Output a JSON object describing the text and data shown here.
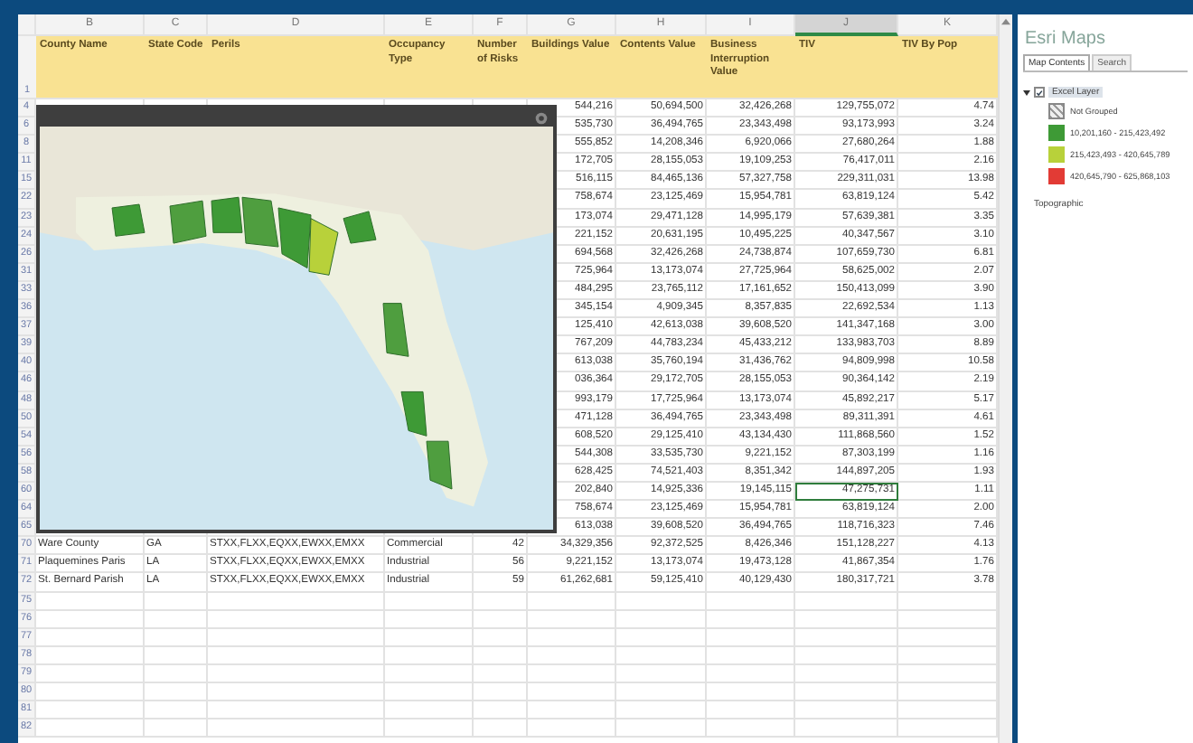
{
  "sheet": {
    "column_letters": [
      {
        "label": "B",
        "selected": false
      },
      {
        "label": "C",
        "selected": false
      },
      {
        "label": "D",
        "selected": false
      },
      {
        "label": "E",
        "selected": false
      },
      {
        "label": "F",
        "selected": false
      },
      {
        "label": "G",
        "selected": false
      },
      {
        "label": "H",
        "selected": false
      },
      {
        "label": "I",
        "selected": false
      },
      {
        "label": "J",
        "selected": true
      },
      {
        "label": "K",
        "selected": false
      }
    ],
    "header_row": {
      "row_number": "1",
      "cells": [
        "County Name",
        "State Code",
        "Perils",
        "Occupancy Type",
        "Number of Risks",
        "Buildings Value",
        "Contents Value",
        "Business Interruption Value",
        "TIV",
        "TIV By Pop"
      ]
    },
    "rows": [
      {
        "row_number": "4",
        "kind": "covered",
        "selected": false,
        "cells": [
          "544,216",
          "50,694,500",
          "32,426,268",
          "129,755,072",
          "4.74"
        ]
      },
      {
        "row_number": "6",
        "kind": "covered",
        "selected": false,
        "cells": [
          "535,730",
          "36,494,765",
          "23,343,498",
          "93,173,993",
          "3.24"
        ]
      },
      {
        "row_number": "8",
        "kind": "covered",
        "selected": false,
        "cells": [
          "555,852",
          "14,208,346",
          "6,920,066",
          "27,680,264",
          "1.88"
        ]
      },
      {
        "row_number": "11",
        "kind": "covered",
        "selected": false,
        "cells": [
          "172,705",
          "28,155,053",
          "19,109,253",
          "76,417,011",
          "2.16"
        ]
      },
      {
        "row_number": "15",
        "kind": "covered",
        "selected": false,
        "cells": [
          "516,115",
          "84,465,136",
          "57,327,758",
          "229,311,031",
          "13.98"
        ]
      },
      {
        "row_number": "22",
        "kind": "covered",
        "selected": false,
        "cells": [
          "758,674",
          "23,125,469",
          "15,954,781",
          "63,819,124",
          "5.42"
        ]
      },
      {
        "row_number": "23",
        "kind": "covered",
        "selected": false,
        "cells": [
          "173,074",
          "29,471,128",
          "14,995,179",
          "57,639,381",
          "3.35"
        ]
      },
      {
        "row_number": "24",
        "kind": "covered",
        "selected": false,
        "cells": [
          "221,152",
          "20,631,195",
          "10,495,225",
          "40,347,567",
          "3.10"
        ]
      },
      {
        "row_number": "26",
        "kind": "covered",
        "selected": false,
        "cells": [
          "694,568",
          "32,426,268",
          "24,738,874",
          "107,659,730",
          "6.81"
        ]
      },
      {
        "row_number": "31",
        "kind": "covered",
        "selected": false,
        "cells": [
          "725,964",
          "13,173,074",
          "27,725,964",
          "58,625,002",
          "2.07"
        ]
      },
      {
        "row_number": "33",
        "kind": "covered",
        "selected": false,
        "cells": [
          "484,295",
          "23,765,112",
          "17,161,652",
          "150,413,099",
          "3.90"
        ]
      },
      {
        "row_number": "36",
        "kind": "covered",
        "selected": false,
        "cells": [
          "345,154",
          "4,909,345",
          "8,357,835",
          "22,692,534",
          "1.13"
        ]
      },
      {
        "row_number": "37",
        "kind": "covered",
        "selected": false,
        "cells": [
          "125,410",
          "42,613,038",
          "39,608,520",
          "141,347,168",
          "3.00"
        ]
      },
      {
        "row_number": "39",
        "kind": "covered",
        "selected": false,
        "cells": [
          "767,209",
          "44,783,234",
          "45,433,212",
          "133,983,703",
          "8.89"
        ]
      },
      {
        "row_number": "40",
        "kind": "covered",
        "selected": false,
        "cells": [
          "613,038",
          "35,760,194",
          "31,436,762",
          "94,809,998",
          "10.58"
        ]
      },
      {
        "row_number": "46",
        "kind": "covered",
        "selected": false,
        "cells": [
          "036,364",
          "29,172,705",
          "28,155,053",
          "90,364,142",
          "2.19"
        ]
      },
      {
        "row_number": "48",
        "kind": "covered",
        "selected": false,
        "cells": [
          "993,179",
          "17,725,964",
          "13,173,074",
          "45,892,217",
          "5.17"
        ]
      },
      {
        "row_number": "50",
        "kind": "covered",
        "selected": false,
        "cells": [
          "471,128",
          "36,494,765",
          "23,343,498",
          "89,311,391",
          "4.61"
        ]
      },
      {
        "row_number": "54",
        "kind": "covered",
        "selected": false,
        "cells": [
          "608,520",
          "29,125,410",
          "43,134,430",
          "111,868,560",
          "1.52"
        ]
      },
      {
        "row_number": "56",
        "kind": "covered",
        "selected": false,
        "cells": [
          "544,308",
          "33,535,730",
          "9,221,152",
          "87,303,199",
          "1.16"
        ]
      },
      {
        "row_number": "58",
        "kind": "covered",
        "selected": false,
        "cells": [
          "628,425",
          "74,521,403",
          "8,351,342",
          "144,897,205",
          "1.93"
        ]
      },
      {
        "row_number": "60",
        "kind": "covered",
        "selected": true,
        "cells": [
          "202,840",
          "14,925,336",
          "19,145,115",
          "47,275,731",
          "1.11"
        ]
      },
      {
        "row_number": "64",
        "kind": "covered",
        "selected": false,
        "cells": [
          "758,674",
          "23,125,469",
          "15,954,781",
          "63,819,124",
          "2.00"
        ]
      },
      {
        "row_number": "65",
        "kind": "covered",
        "selected": false,
        "cells": [
          "613,038",
          "39,608,520",
          "36,494,765",
          "118,716,323",
          "7.46"
        ]
      },
      {
        "row_number": "70",
        "kind": "full",
        "selected": false,
        "cells": [
          "Ware County",
          "GA",
          "STXX,FLXX,EQXX,EWXX,EMXX",
          "Commercial",
          "42",
          "34,329,356",
          "92,372,525",
          "8,426,346",
          "151,128,227",
          "4.13"
        ]
      },
      {
        "row_number": "71",
        "kind": "full",
        "selected": false,
        "cells": [
          "Plaquemines Paris",
          "LA",
          "STXX,FLXX,EQXX,EWXX,EMXX",
          "Industrial",
          "56",
          "9,221,152",
          "13,173,074",
          "19,473,128",
          "41,867,354",
          "1.76"
        ]
      },
      {
        "row_number": "72",
        "kind": "full",
        "selected": false,
        "cells": [
          "St. Bernard Parish",
          "LA",
          "STXX,FLXX,EQXX,EWXX,EMXX",
          "Industrial",
          "59",
          "61,262,681",
          "59,125,410",
          "40,129,430",
          "180,317,721",
          "3.78"
        ]
      },
      {
        "row_number": "75",
        "kind": "empty",
        "selected": false
      },
      {
        "row_number": "76",
        "kind": "empty",
        "selected": false
      },
      {
        "row_number": "77",
        "kind": "empty",
        "selected": false
      },
      {
        "row_number": "78",
        "kind": "empty",
        "selected": false
      },
      {
        "row_number": "79",
        "kind": "empty",
        "selected": false
      },
      {
        "row_number": "80",
        "kind": "empty",
        "selected": false
      },
      {
        "row_number": "81",
        "kind": "empty",
        "selected": false
      },
      {
        "row_number": "82",
        "kind": "empty",
        "selected": false
      }
    ]
  },
  "esri_panel": {
    "title": "Esri Maps",
    "tabs": [
      {
        "label": "Map Contents",
        "selected": true
      },
      {
        "label": "Search",
        "selected": false
      }
    ],
    "layers": [
      {
        "kind": "group",
        "label": "Excel Layer",
        "checked": true,
        "expanded": true,
        "children": [
          {
            "label": "Not Grouped",
            "kind": "hatch"
          },
          {
            "label": "10,201,160 - 215,423,492",
            "kind": "swatch",
            "color": "#3e9a36"
          },
          {
            "label": "215,423,493 - 420,645,789",
            "kind": "swatch",
            "color": "#b8d13a"
          },
          {
            "label": "420,645,790 - 625,868,103",
            "kind": "swatch",
            "color": "#e23b35"
          }
        ]
      },
      {
        "kind": "basemap",
        "label": "Topographic"
      }
    ]
  }
}
